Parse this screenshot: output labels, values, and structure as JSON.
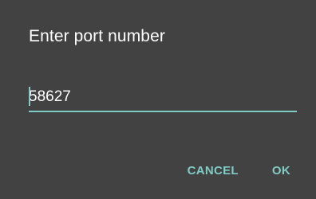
{
  "dialog": {
    "title": "Enter port number",
    "input": {
      "value": "58627"
    },
    "buttons": {
      "cancel_label": "CANCEL",
      "ok_label": "OK"
    }
  },
  "colors": {
    "dialog_background": "#424242",
    "accent": "#80cbc4",
    "title_text": "#ffffff"
  }
}
